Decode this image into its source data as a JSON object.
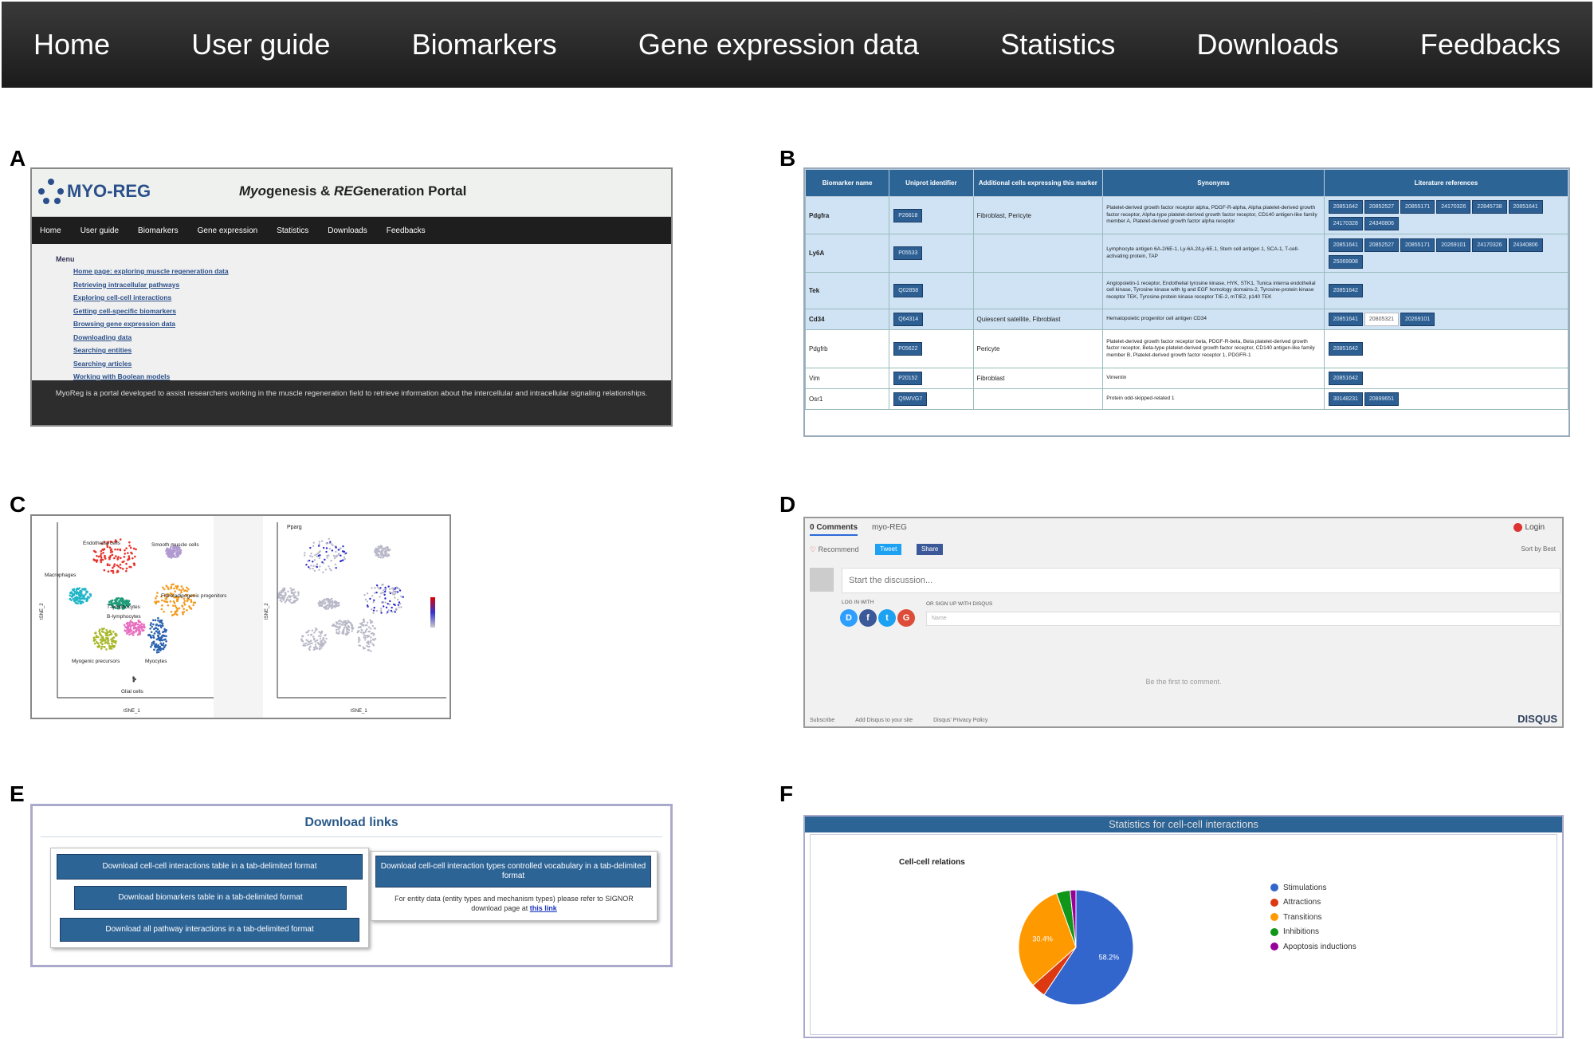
{
  "nav": [
    "Home",
    "User guide",
    "Biomarkers",
    "Gene expression data",
    "Statistics",
    "Downloads",
    "Feedbacks"
  ],
  "labels": {
    "a": "A",
    "b": "B",
    "c": "C",
    "d": "D",
    "e": "E",
    "f": "F"
  },
  "panelA": {
    "logo": "MYO-REG",
    "title_parts": [
      "Myo",
      "genesis & ",
      "REG",
      "eneration Portal"
    ],
    "subnav": [
      "Home",
      "User guide",
      "Biomarkers",
      "Gene expression",
      "Statistics",
      "Downloads",
      "Feedbacks"
    ],
    "menu_head": "Menu",
    "menu": [
      "Home page: exploring muscle regeneration data",
      "Retrieving intracellular pathways",
      "Exploring cell-cell interactions",
      "Getting cell-specific biomarkers",
      "Browsing gene expression data",
      "Downloading data",
      "Searching entities",
      "Searching articles",
      "Working with Boolean models"
    ],
    "footer": "MyoReg is a portal developed to assist researchers working in the muscle regeneration field to retrieve information about the intercellular and intracellular signaling relationships."
  },
  "panelB": {
    "headers": [
      "Biomarker name",
      "Uniprot identifier",
      "Additional cells expressing this marker",
      "Synonyms",
      "Literature references"
    ],
    "rows": [
      {
        "name": "Pdgfra",
        "uniprot": "P26618",
        "cells": "Fibroblast, Pericyte",
        "syn": "Platelet-derived growth factor receptor alpha, PDGF-R-alpha, Alpha platelet-derived growth factor receptor, Alpha-type platelet-derived growth factor receptor, CD140 antigen-like family member A, Platelet-derived growth factor alpha receptor",
        "refs": [
          "20851642",
          "20852527",
          "20855171",
          "24170326",
          "22845738",
          "20851641",
          "24170328",
          "24340806"
        ],
        "hl": true
      },
      {
        "name": "Ly6A",
        "uniprot": "P05533",
        "cells": "",
        "syn": "Lymphocyte antigen 6A-2/6E-1, Ly-6A.2/Ly-6E.1, Stem cell antigen 1, SCA-1, T-cell-activating protein, TAP",
        "refs": [
          "20851641",
          "20852527",
          "20855171",
          "20269101",
          "24170326",
          "24340806",
          "25069908"
        ],
        "hl": true
      },
      {
        "name": "Tek",
        "uniprot": "Q02858",
        "cells": "",
        "syn": "Angiopoietin-1 receptor, Endothelial tyrosine kinase, HYK, STK1, Tunica interna endothelial cell kinase, Tyrosine kinase with Ig and EGF homology domains-2, Tyrosine-protein kinase receptor TEK, Tyrosine-protein kinase receptor TIE-2, mTIE2, p140 TEK",
        "refs": [
          "20851642"
        ],
        "hl": true
      },
      {
        "name": "Cd34",
        "uniprot": "Q64314",
        "cells": "Quiescent satellite, Fibroblast",
        "syn": "Hematopoietic progenitor cell antigen CD34",
        "refs": [
          "20851641",
          "20805321",
          "20269101"
        ],
        "hl": true
      },
      {
        "name": "Pdgfrb",
        "uniprot": "P05622",
        "cells": "Pericyte",
        "syn": "Platelet-derived growth factor receptor beta, PDGF-R-beta, Beta platelet-derived growth factor receptor, Beta-type platelet-derived growth factor receptor, CD140 antigen-like family member B, Platelet-derived growth factor receptor 1, PDGFR-1",
        "refs": [
          "20851642"
        ],
        "hl": false
      },
      {
        "name": "Vim",
        "uniprot": "P20152",
        "cells": "Fibroblast",
        "syn": "Vimentin",
        "refs": [
          "20851642"
        ],
        "hl": false
      },
      {
        "name": "Osr1",
        "uniprot": "Q9WVG7",
        "cells": "",
        "syn": "Protein odd-skipped-related 1",
        "refs": [
          "30148231",
          "20899651"
        ],
        "hl": false
      }
    ]
  },
  "panelC": {
    "clusters": [
      "Endothelial cells",
      "Smooth muscle cells",
      "Macrophages",
      "Fibro/adipogenic progenitors",
      "T-lymphocytes",
      "B-lymphocytes",
      "Myogenic precursors",
      "Myocytes",
      "Glial cells"
    ],
    "right_title": "Pparg",
    "xlab": "tSNE_1",
    "ylab": "tSNE_2"
  },
  "panelD": {
    "tab1": "0 Comments",
    "tab2": "myo-REG",
    "login": "Login",
    "recommend": "Recommend",
    "tweet": "Tweet",
    "share": "Share",
    "sort": "Sort by Best",
    "start": "Start the discussion...",
    "login_with": "LOG IN WITH",
    "or_sign": "OR SIGN UP WITH DISQUS",
    "name_ph": "Name",
    "first": "Be the first to comment.",
    "subscribe": "Subscribe",
    "add": "Add Disqus to your site",
    "privacy": "Disqus' Privacy Policy",
    "brand": "DISQUS"
  },
  "panelE": {
    "title": "Download links",
    "btn1": "Download cell-cell interactions table in a tab-delimited format",
    "btn2": "Download biomarkers table in a tab-delimited format",
    "btn3": "Download all pathway interactions in a tab-delimited format",
    "btn4": "Download cell-cell interaction types controlled vocabulary in a tab-delimited format",
    "note": "For entity data (entity types and mechanism types) please refer to SIGNOR download page at",
    "link": "this link"
  },
  "panelF": {
    "header": "Statistics for cell-cell interactions",
    "title": "Cell-cell relations"
  },
  "chart_data": {
    "type": "pie",
    "title": "Cell-cell relations",
    "categories": [
      "Stimulations",
      "Attractions",
      "Transitions",
      "Inhibitions",
      "Apoptosis inductions"
    ],
    "values": [
      58.2,
      4.0,
      30.4,
      3.8,
      1.6
    ],
    "colors": [
      "#3366cc",
      "#dc3912",
      "#ff9900",
      "#109618",
      "#990099"
    ],
    "slice_labels": [
      "58.2%",
      "",
      "30.4%",
      "",
      ""
    ],
    "legend": "right"
  }
}
